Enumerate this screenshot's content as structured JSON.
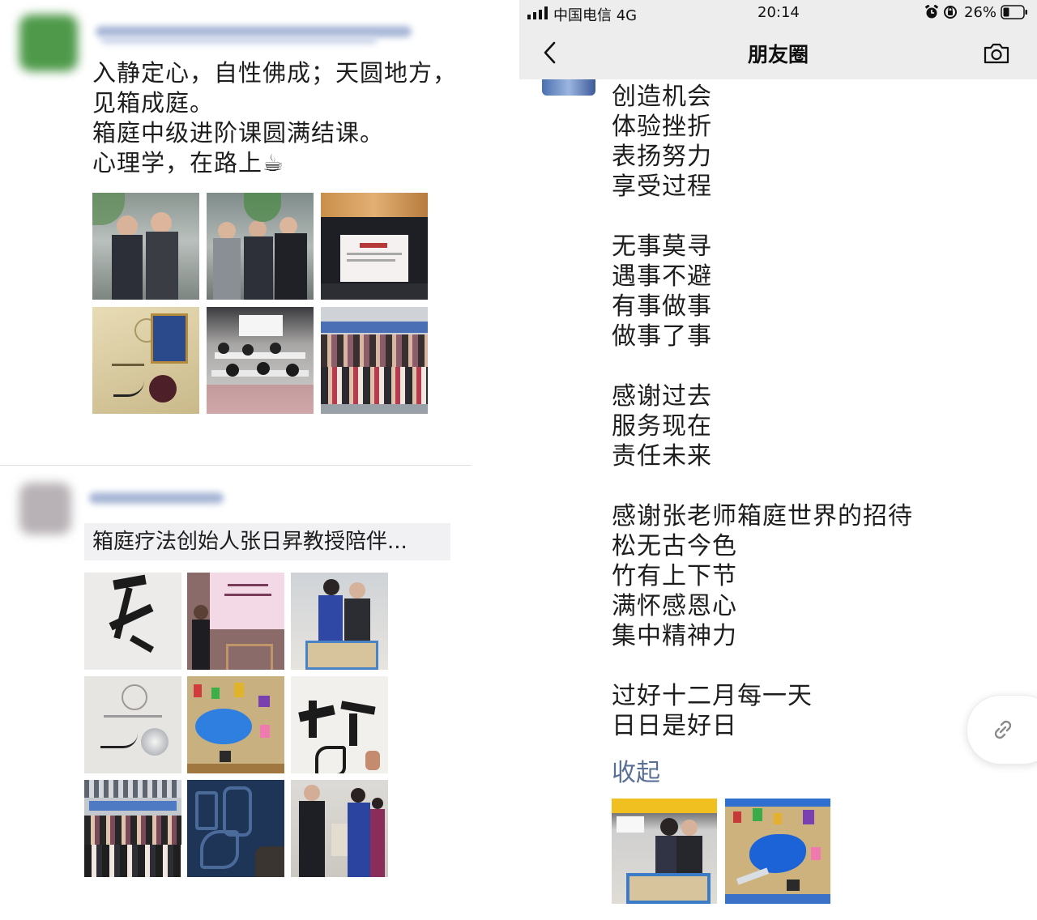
{
  "left": {
    "post1": {
      "lines": [
        "入静定心，自性佛成；天圆地方，",
        "见箱成庭。",
        "箱庭中级进阶课圆满结课。",
        "心理学，在路上☕"
      ],
      "photos": [
        {
          "icon": "photo-two-men-standing"
        },
        {
          "icon": "photo-three-men-thumbs-up"
        },
        {
          "icon": "photo-lecture-screen"
        },
        {
          "icon": "photo-certificate-seal"
        },
        {
          "icon": "photo-classroom-audience"
        },
        {
          "icon": "photo-group-photo"
        }
      ]
    },
    "post2": {
      "share_text": "箱庭疗法创始人张日昇教授陪伴...",
      "photos": [
        {
          "icon": "photo-calligraphy"
        },
        {
          "icon": "photo-speaker-stage"
        },
        {
          "icon": "photo-two-people-sandtray"
        },
        {
          "icon": "photo-certificate-silver-seal"
        },
        {
          "icon": "photo-sandtray-figures"
        },
        {
          "icon": "photo-calligraphy-book"
        },
        {
          "icon": "photo-group-photo"
        },
        {
          "icon": "photo-calligraphy-blue"
        },
        {
          "icon": "photo-people-at-table"
        }
      ]
    }
  },
  "right": {
    "status": {
      "carrier": "中国电信 4G",
      "time": "20:14",
      "battery": "26%"
    },
    "nav": {
      "title": "朋友圈"
    },
    "poem": [
      "创造机会",
      "体验挫折",
      "表扬努力",
      "享受过程",
      "无事莫寻",
      "遇事不避",
      "有事做事",
      "做事了事",
      "感谢过去",
      "服务现在",
      "责任未来",
      "感谢张老师箱庭世界的招待",
      "松无古今色",
      "竹有上下节",
      "满怀感恩心",
      "集中精神力",
      "过好十二月每一天",
      "日日是好日"
    ],
    "collapse_label": "收起",
    "photos": [
      {
        "icon": "photo-two-people-sandtray"
      },
      {
        "icon": "photo-sandtray-blue-lake"
      }
    ]
  }
}
